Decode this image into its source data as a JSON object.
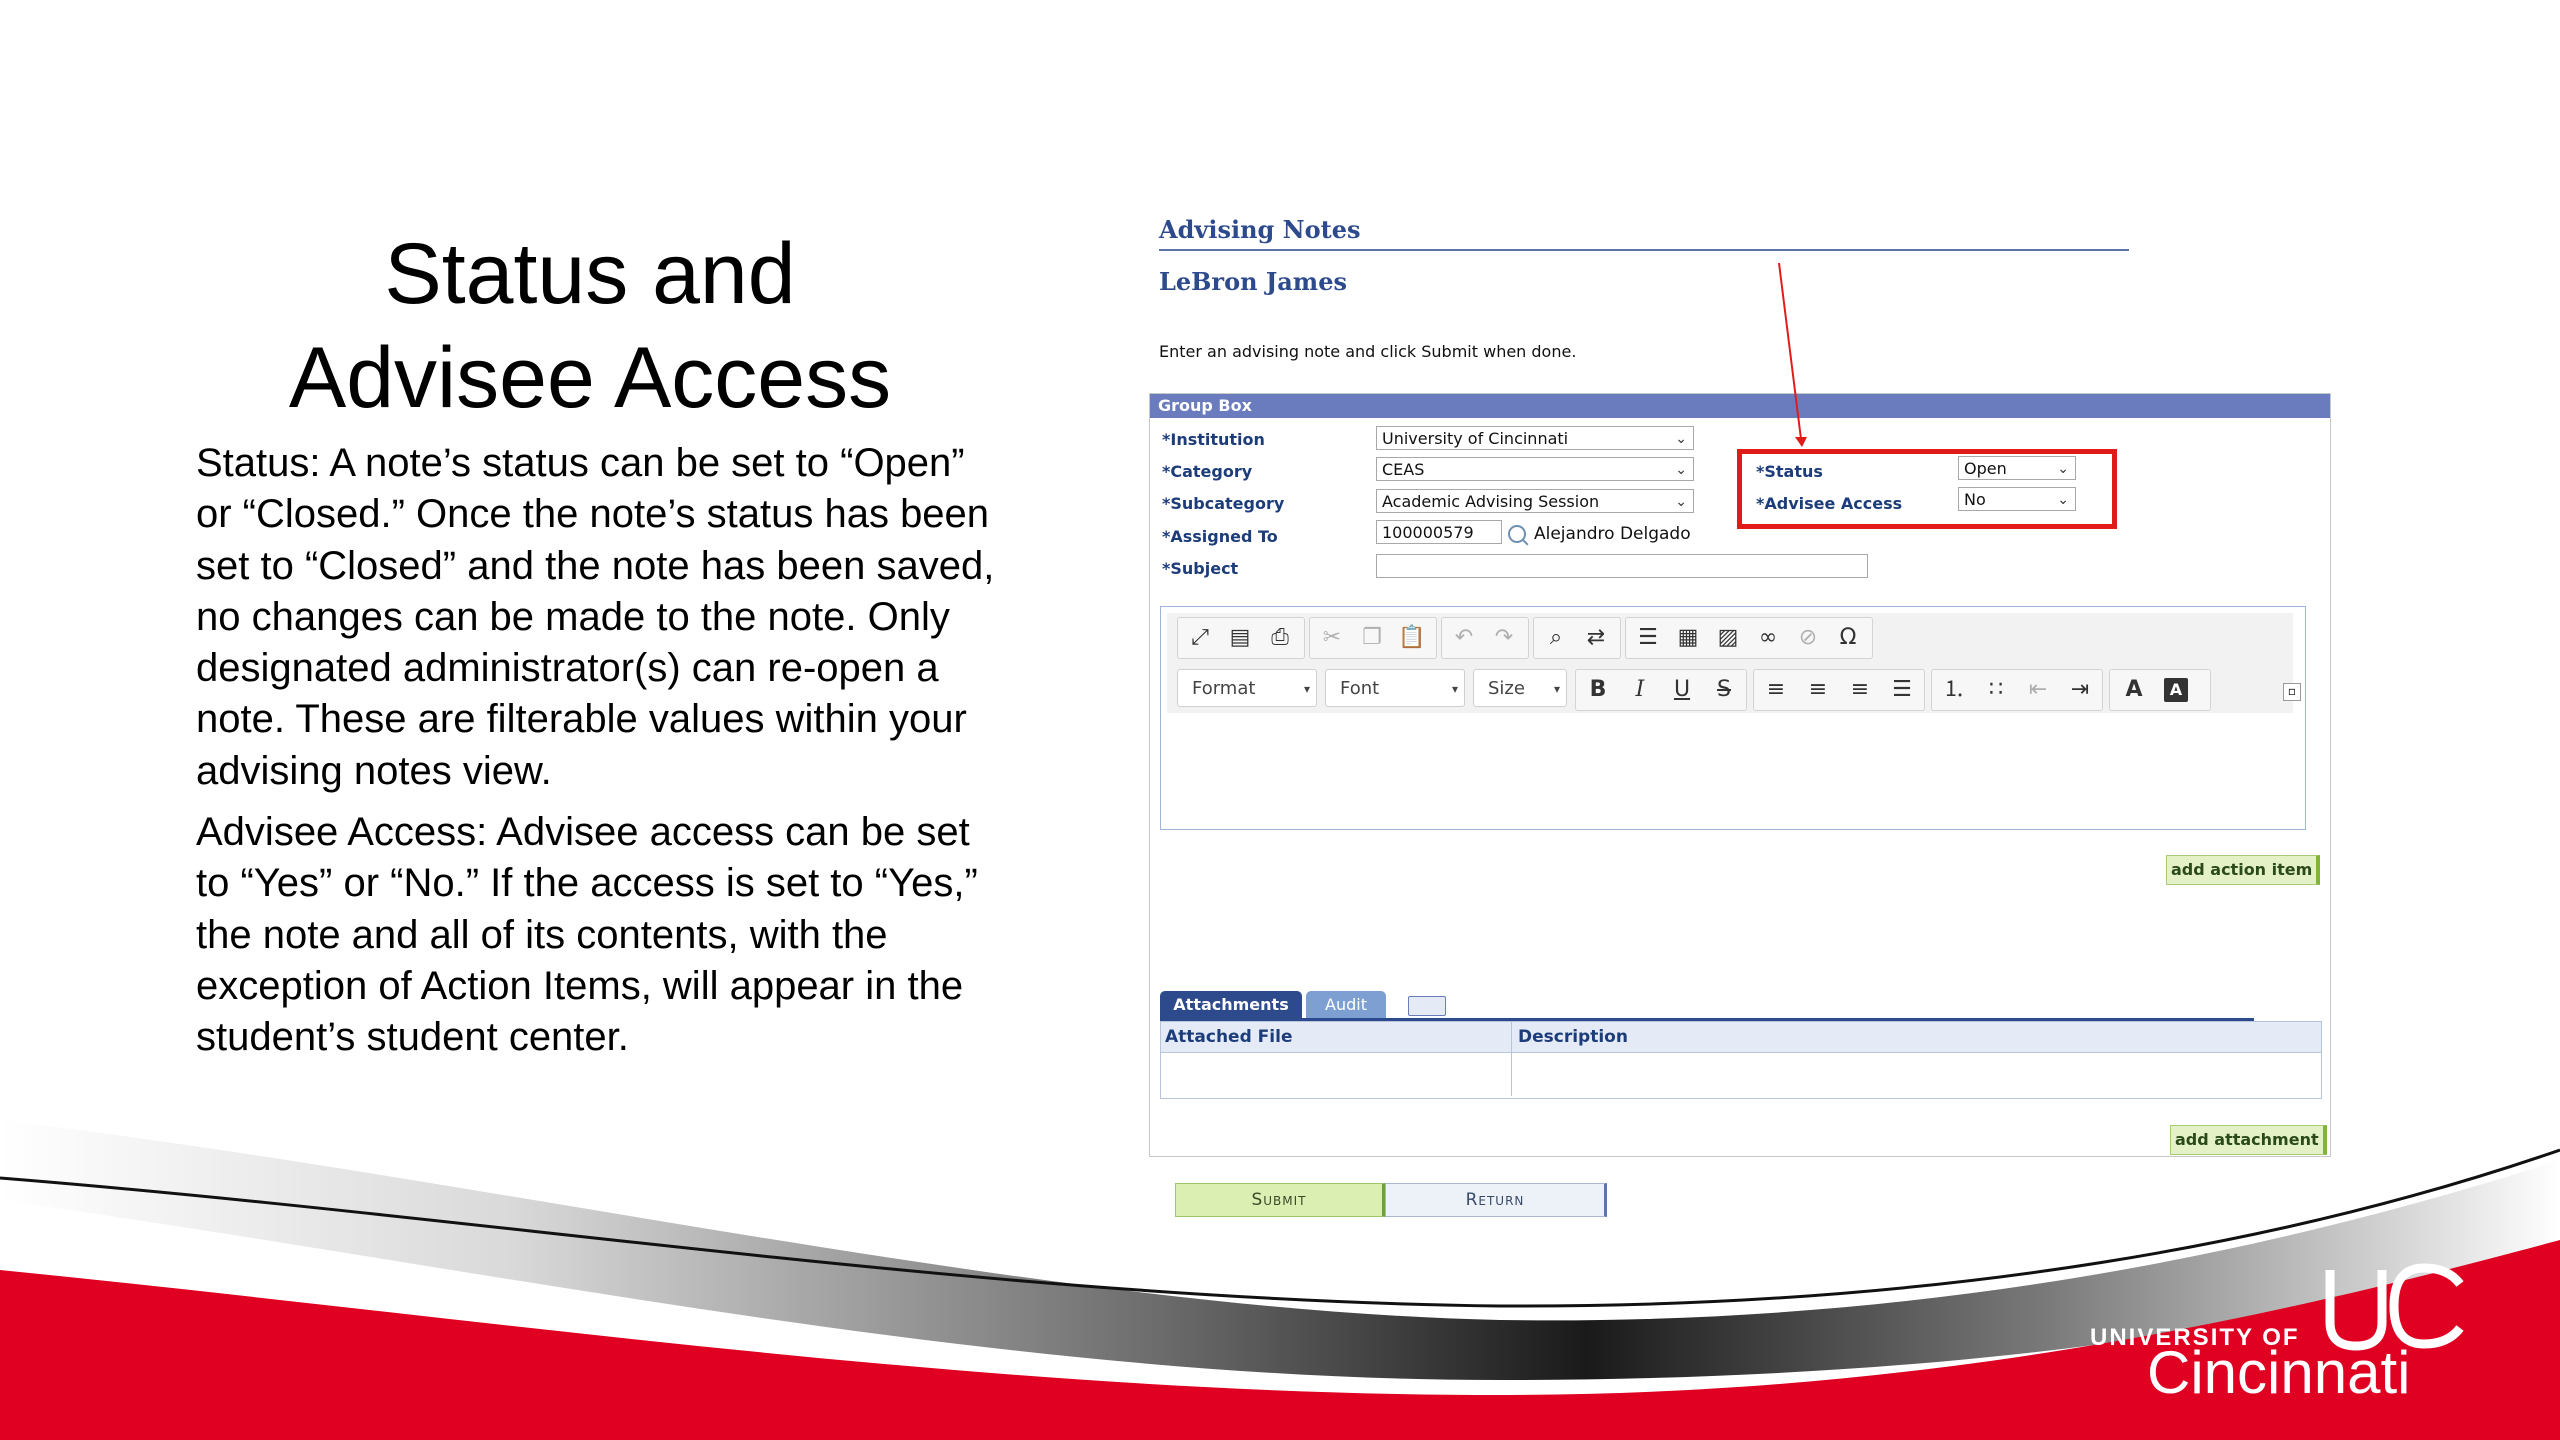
{
  "slide": {
    "title_line1": "Status and",
    "title_line2": "Advisee Access",
    "paragraph1": "Status: A note’s status can be set to “Open” or “Closed.” Once the note’s status has been set to “Closed” and the note has been saved, no changes can be made to the note. Only designated administrator(s) can re-open a note. These are filterable values within your advising notes view.",
    "paragraph2": "Advisee Access: Advisee access can be set to “Yes” or “No.” If the access is set to “Yes,” the note and all of its contents, with the exception of Action Items, will appear in the student’s student center."
  },
  "screenshot": {
    "page_title": "Advising Notes",
    "student_name": "LeBron James",
    "instructions": "Enter an advising note and click Submit when done.",
    "group_box_title": "Group Box",
    "fields": {
      "institution_label": "*Institution",
      "institution_value": "University of Cincinnati",
      "category_label": "*Category",
      "category_value": "CEAS",
      "subcategory_label": "*Subcategory",
      "subcategory_value": "Academic Advising Session",
      "assigned_to_label": "*Assigned To",
      "assigned_to_id": "100000579",
      "assigned_to_name": "Alejandro Delgado",
      "subject_label": "*Subject",
      "subject_value": "",
      "status_label": "*Status",
      "status_value": "Open",
      "advisee_access_label": "*Advisee Access",
      "advisee_access_value": "No"
    },
    "editor": {
      "format_label": "Format",
      "font_label": "Font",
      "size_label": "Size",
      "bold": "B",
      "italic": "I",
      "underline": "U",
      "strike": "S",
      "omega": "Ω",
      "text_color": "A",
      "bg_color": "A"
    },
    "add_action_item_label": "add action item",
    "tabs": {
      "attachments": "Attachments",
      "audit": "Audit"
    },
    "grid": {
      "col_attached_file": "Attached File",
      "col_description": "Description"
    },
    "add_attachment_label": "add attachment",
    "submit_label": "Submit",
    "return_label": "Return"
  },
  "logo": {
    "line1": "UNIVERSITY OF",
    "line2": "Cincinnati"
  },
  "colors": {
    "brand_red": "#e00122",
    "link_blue": "#2d4a8c",
    "highlight_red": "#e11a1a"
  }
}
